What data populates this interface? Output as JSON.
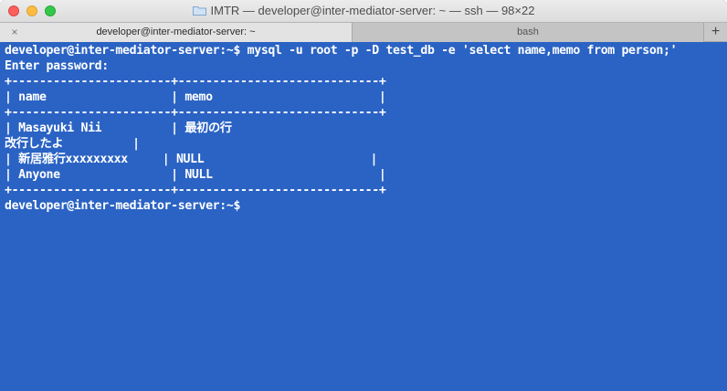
{
  "window": {
    "title": "IMTR — developer@inter-mediator-server: ~ — ssh — 98×22"
  },
  "tabs": [
    {
      "label": "developer@inter-mediator-server: ~",
      "close": "×",
      "active": true
    },
    {
      "label": "bash",
      "active": false
    }
  ],
  "tab_add_label": "+",
  "terminal": {
    "lines": [
      "developer@inter-mediator-server:~$ mysql -u root -p -D test_db -e 'select name,memo from person;'",
      "Enter password:",
      "+-----------------------+-----------------------------+",
      "| name                  | memo                        |",
      "+-----------------------+-----------------------------+",
      "| Masayuki Nii          | 最初の行",
      "改行したよ          |",
      "| 新居雅行xxxxxxxxx     | NULL                        |",
      "| Anyone                | NULL                        |",
      "+-----------------------+-----------------------------+",
      "developer@inter-mediator-server:~$"
    ]
  },
  "colors": {
    "terminal_bg": "#2b63c4",
    "terminal_fg": "#ffffff"
  }
}
